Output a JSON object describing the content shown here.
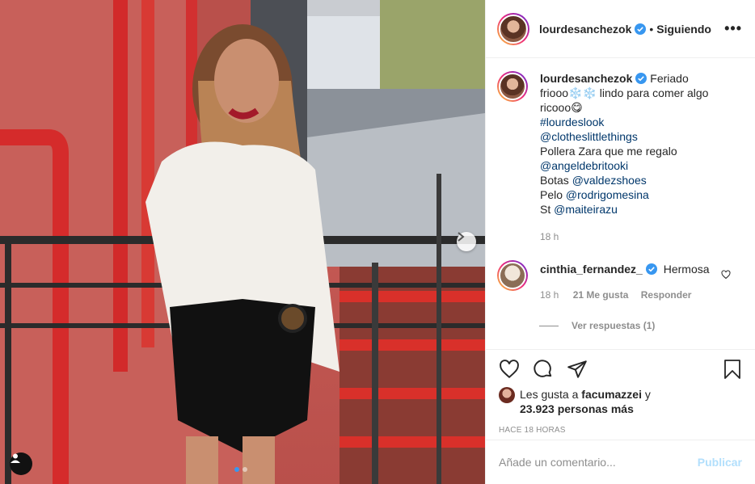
{
  "post": {
    "images": {
      "count": 2,
      "current": 1
    }
  },
  "header": {
    "username": "lourdesanchezok",
    "separator": "•",
    "follow_status": "Siguiendo",
    "more": "•••"
  },
  "caption": {
    "username": "lourdesanchezok",
    "line1": "Feriado",
    "line2": "friooo❄️❄️ lindo para comer algo",
    "line3": "ricooo😋",
    "hashtag": "#lourdeslook",
    "mention1": "@clotheslittlethings",
    "text_skirt": "Pollera Zara que me regalo",
    "mention2": "@angeldebritooki",
    "boots_label": "Botas ",
    "mention3": "@valdezshoes",
    "hair_label": "Pelo ",
    "mention4": "@rodrigomesina",
    "st_label": "St ",
    "mention5": "@maiteirazu",
    "time": "18 h"
  },
  "comment": {
    "username": "cinthia_fernandez_",
    "text": "Hermosa",
    "time": "18 h",
    "likes": "21 Me gusta",
    "reply": "Responder",
    "view_replies": "Ver respuestas (1)"
  },
  "likes": {
    "prefix": "Les gusta a ",
    "user": "facumazzei",
    "connector": " y",
    "others": "23.923 personas más"
  },
  "timestamp": "HACE 18 HORAS",
  "add_comment": {
    "placeholder": "Añade un comentario...",
    "publish": "Publicar"
  },
  "colors": {
    "verified": "#3897f0",
    "link": "#00376b",
    "publish_disabled": "#b2dffc",
    "muted": "#8e8e8e"
  }
}
